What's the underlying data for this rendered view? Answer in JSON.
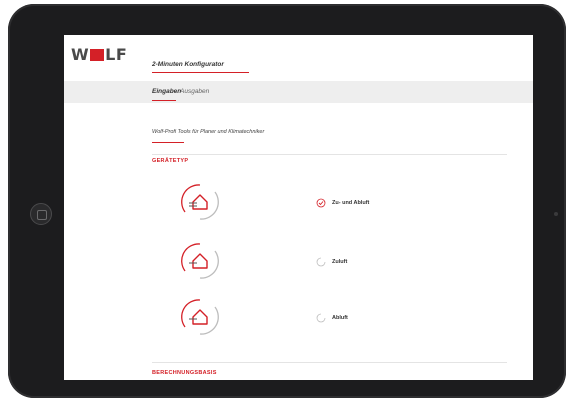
{
  "logo": {
    "text_left": "W",
    "text_right": "LF"
  },
  "header": {
    "title": "2-Minuten Konfigurator"
  },
  "tabs": [
    {
      "label": "Eingaben",
      "active": true
    },
    {
      "label": "Ausgaben",
      "active": false
    }
  ],
  "subtitle": "Wolf-Profi Tools für Planer und Klimatechniker",
  "sections": {
    "device_type": "GERÄTETYP",
    "calculation_basis": "BERECHNUNGSBASIS"
  },
  "options": [
    {
      "label": "Zu- und Abluft",
      "selected": true,
      "icon": "house-supply-exhaust-icon"
    },
    {
      "label": "Zuluft",
      "selected": false,
      "icon": "house-supply-icon"
    },
    {
      "label": "Abluft",
      "selected": false,
      "icon": "house-exhaust-icon"
    }
  ],
  "colors": {
    "accent": "#d42027",
    "tabbar": "#eeeeee",
    "device": "#1c1c1e"
  }
}
